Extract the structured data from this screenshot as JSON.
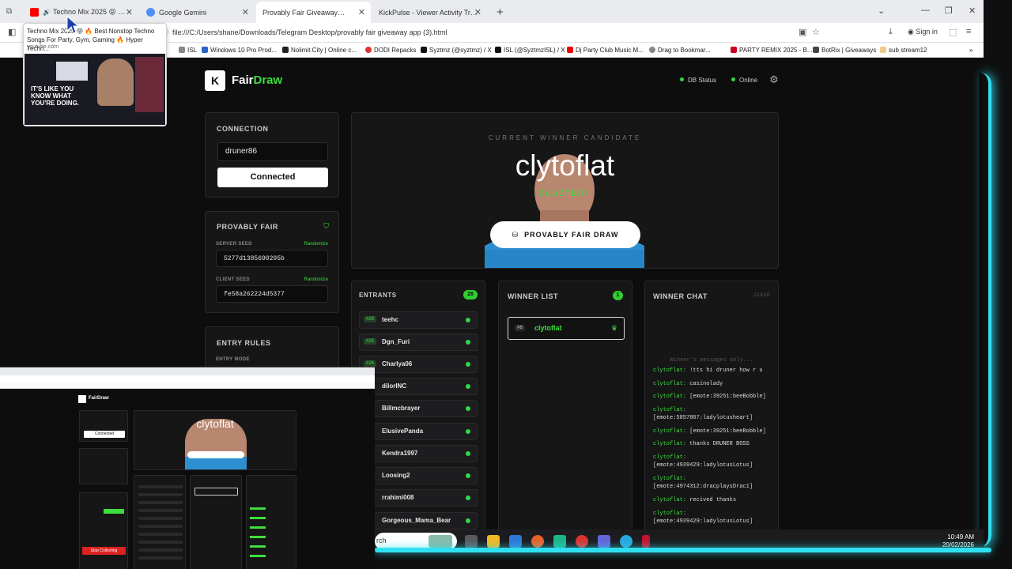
{
  "browser": {
    "tabs": [
      {
        "title": "Techno Mix 2025 😝 🔥 Be",
        "active": false,
        "favicon_color": "#ff0000"
      },
      {
        "title": "Google Gemini",
        "active": false,
        "favicon_color": "#4f8ff7"
      },
      {
        "title": "Provably Fair Giveaway Bot",
        "active": true,
        "favicon_color": ""
      },
      {
        "title": "KickPulse - Viewer Activity Tracker",
        "active": false,
        "favicon_color": ""
      }
    ],
    "url": "file:///C:/Users/shane/Downloads/Telegram Desktop/provably fair giveaway app (3).html",
    "sign_in": "Sign in",
    "bookmarks": [
      "ISL",
      "Windows 10 Pro Prod...",
      "Nolimit City | Online c...",
      "DODI Repacks",
      "Syztmz (@syztmz) / X",
      "ISL (@SyztmzISL) / X",
      "Dj Party Club Music M...",
      "Drag to Bookmar...",
      "PARTY REMIX 2025 - B...",
      "BotRix | Giveaways",
      "sub stream12"
    ],
    "tooltip": {
      "title": "Techno Mix 2025 😝 🔥 Best Nonstop Techno Songs For Party, Gym, Gaming 🔥 Hyper Techn...",
      "source": "youtube.com",
      "thumb_text": "IT'S LIKE YOU KNOW WHAT YOU'RE DOING."
    }
  },
  "app": {
    "logo_letter": "K",
    "brand_a": "Fair",
    "brand_b": "Draw",
    "db_status": "DB Status",
    "online": "Online",
    "connection": {
      "header": "CONNECTION",
      "username": "druner86",
      "button": "Connected"
    },
    "provably_fair": {
      "header": "PROVABLY FAIR",
      "server_label": "SERVER SEED",
      "server_seed": "5277d1385690295b",
      "client_label": "CLIENT SEED",
      "client_seed": "fe58a262224d5377",
      "randomize": "Randomize"
    },
    "entry_rules": {
      "header": "ENTRY RULES",
      "mode_label": "ENTRY MODE"
    },
    "candidate": {
      "label": "CURRENT WINNER CANDIDATE",
      "name": "clytoflat",
      "status": "CLAIMED!",
      "draw_button": "PROVABLY FAIR DRAW"
    },
    "entrants": {
      "header": "ENTRANTS",
      "count": "28",
      "list": [
        {
          "num": "#28",
          "name": "teehc"
        },
        {
          "num": "#25",
          "name": "Dgn_Furi"
        },
        {
          "num": "#26",
          "name": "Charlya06"
        },
        {
          "num": "",
          "name": "dilorINC"
        },
        {
          "num": "",
          "name": "Billmcbrayer"
        },
        {
          "num": "",
          "name": "ElusivePanda"
        },
        {
          "num": "",
          "name": "Kendra1997"
        },
        {
          "num": "",
          "name": "Loosing2"
        },
        {
          "num": "",
          "name": "rrahimi008"
        },
        {
          "num": "",
          "name": "Gorgeous_Mama_Bear"
        }
      ]
    },
    "winners": {
      "header": "WINNER LIST",
      "count": "1",
      "list": [
        {
          "num": "#8",
          "name": "clytoflat"
        }
      ]
    },
    "chat": {
      "header": "WINNER CHAT",
      "clear": "CLEAR",
      "placeholder": "Winner's messages only...",
      "messages": [
        {
          "user": "clytoflat:",
          "text": "!tts hi druner how r u"
        },
        {
          "user": "clytoflat:",
          "text": "casinolady"
        },
        {
          "user": "clytoflat:",
          "text": "[emote:39251:beeBobble]"
        },
        {
          "user": "clytoflat:",
          "text": "[emote:5857807:ladylotusheart]"
        },
        {
          "user": "clytoflat:",
          "text": "[emote:39251:beeBobble]"
        },
        {
          "user": "clytoflat:",
          "text": "thanks DRUNER BOSS"
        },
        {
          "user": "clytoflat:",
          "text": "[emote:4939429:ladylotusLotus]"
        },
        {
          "user": "clytoflat:",
          "text": "[emote:4974312:dracplaysDrac1]"
        },
        {
          "user": "clytoflat:",
          "text": "recived thanks"
        },
        {
          "user": "clytoflat:",
          "text": "[emote:4939429:ladylotusLotus]"
        }
      ]
    }
  },
  "taskbar": {
    "search_text": "rch",
    "time": "10:49 AM",
    "date": "20/02/2026"
  },
  "mini": {
    "brand": "FairDraw",
    "name": "clytoflat",
    "connected": "Connected",
    "start_button": "Stop Collecting"
  },
  "colors": {
    "accent": "#3dde3d",
    "neon": "#2fe0f0",
    "bg": "#0d0d0e",
    "panel": "#161617"
  }
}
